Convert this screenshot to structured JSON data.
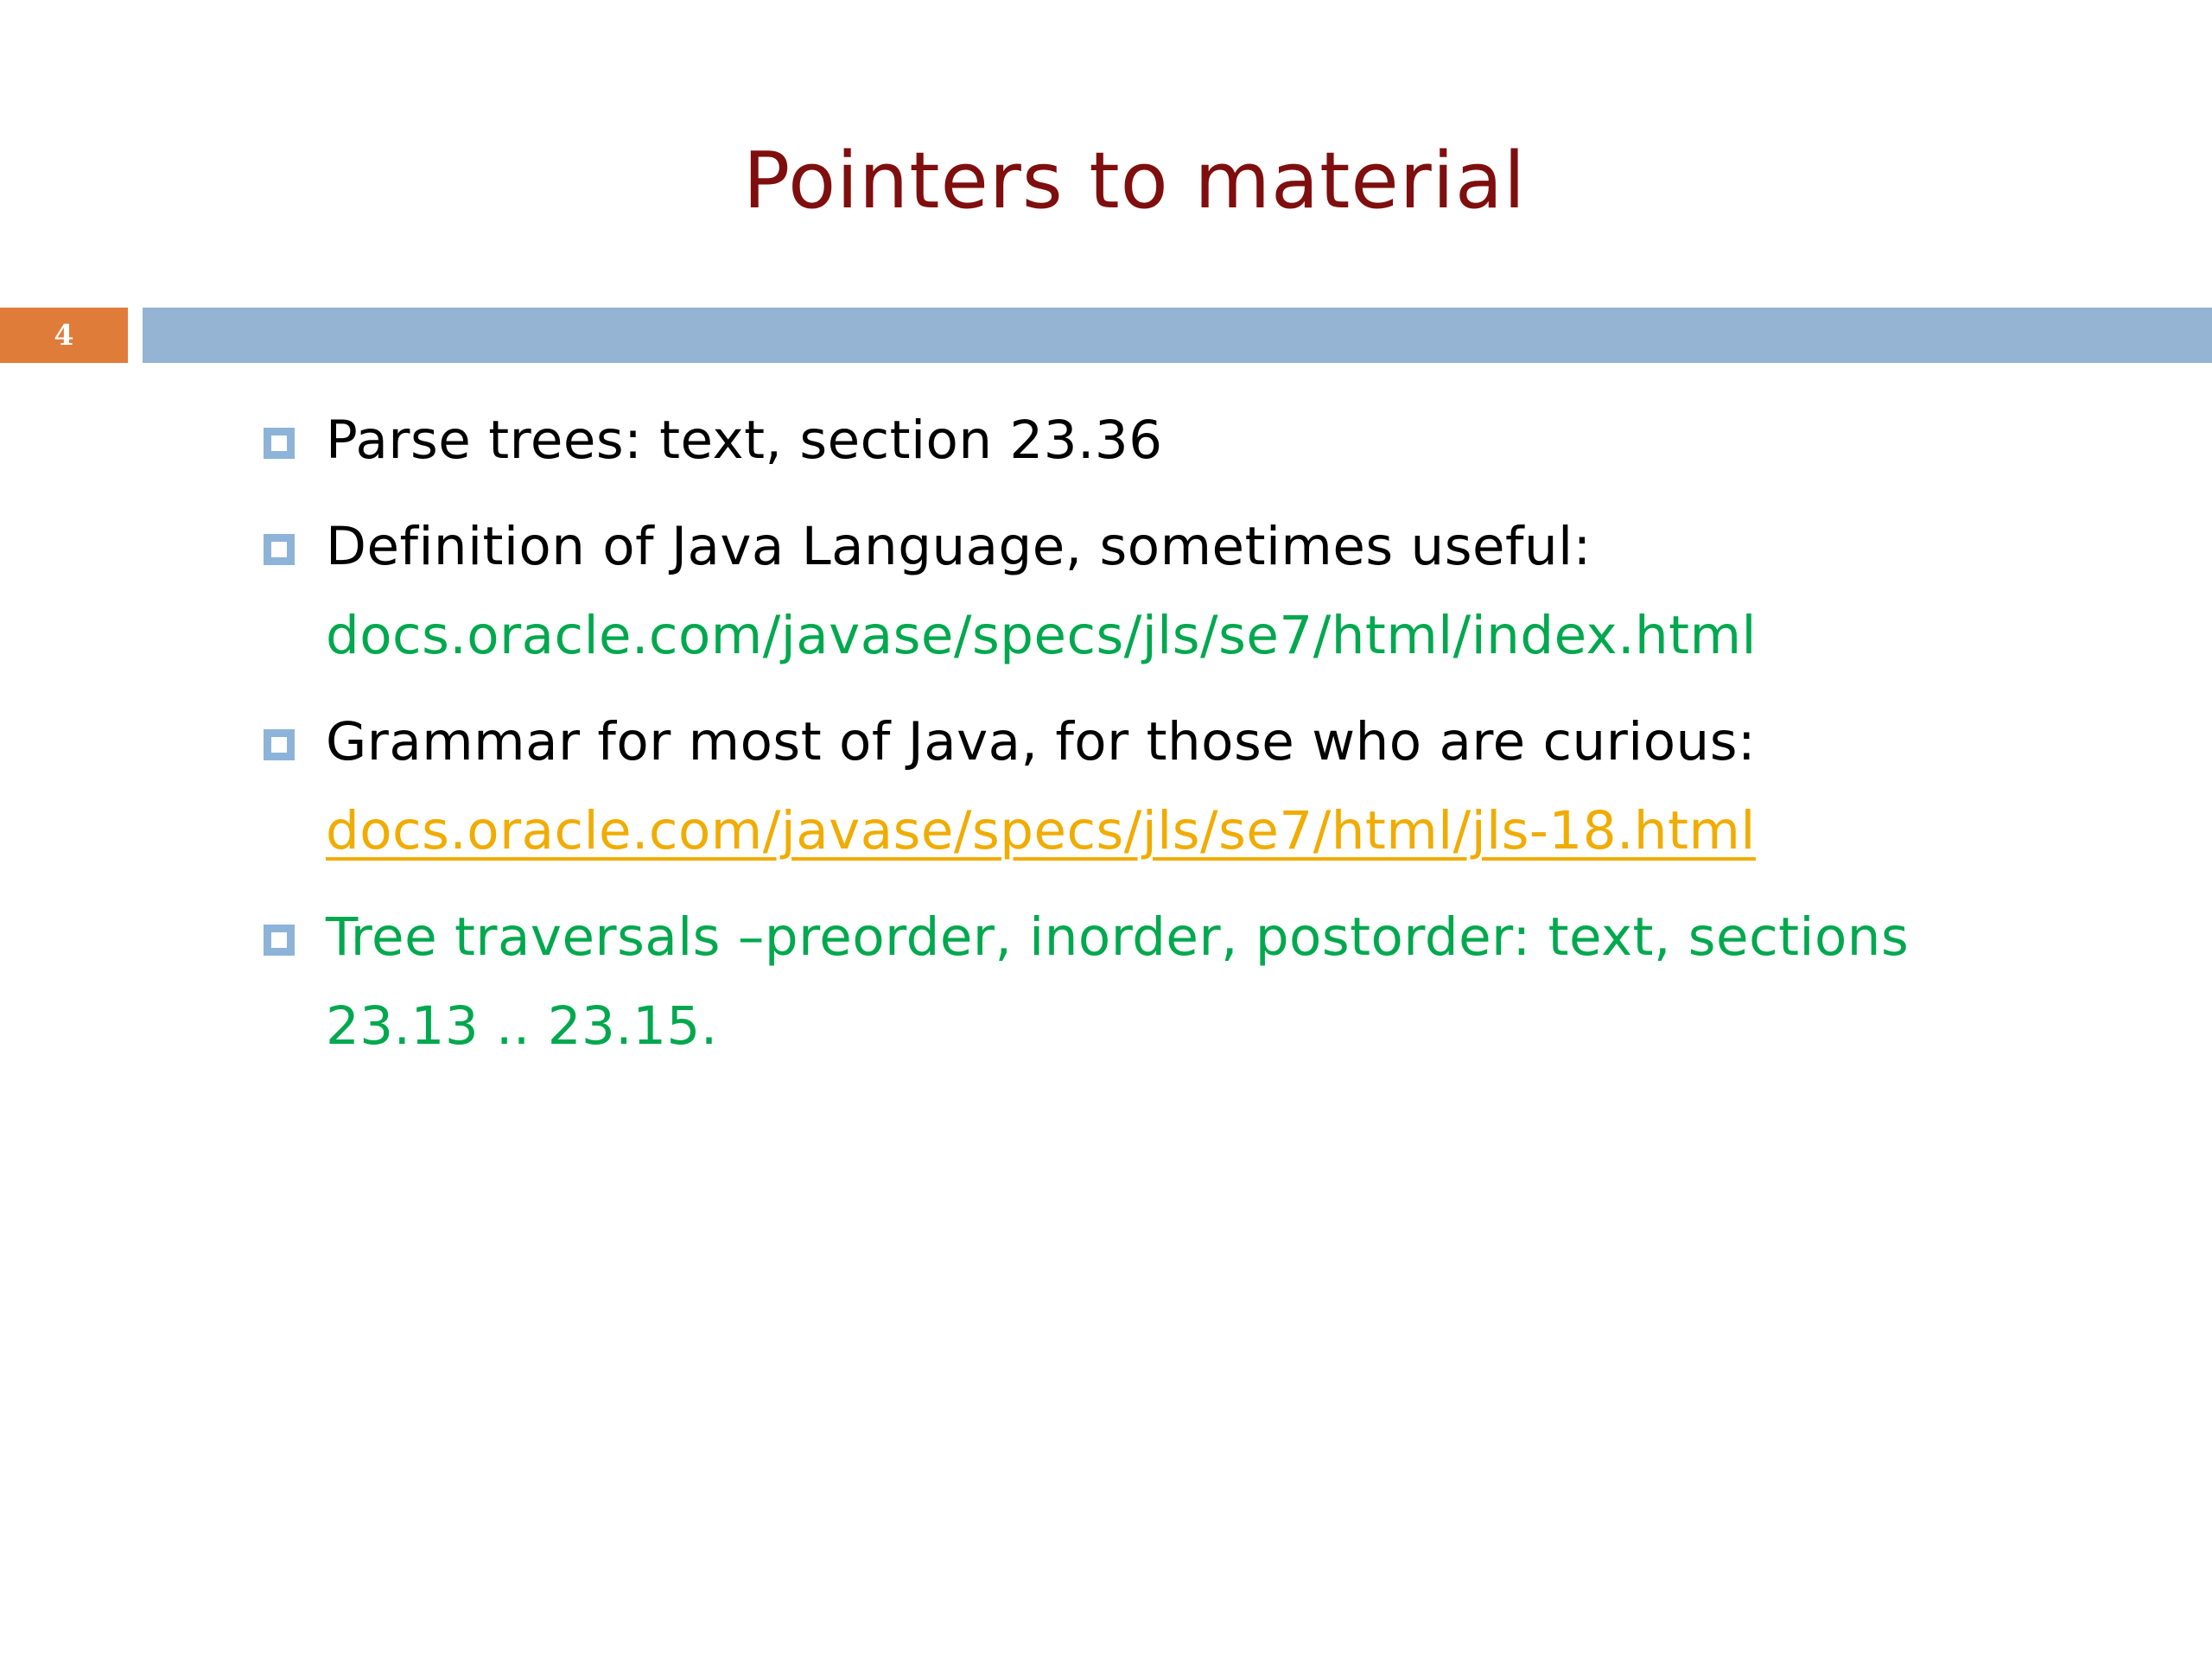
{
  "colors": {
    "title": "#7f0e0e",
    "slide_number_box": "#e07c3a",
    "header_bar": "#95b3d3",
    "bullet_marker": "#8eb3d8",
    "body_text": "#000000",
    "green_text": "#00a84e",
    "orange_link": "#f0ac00"
  },
  "slide": {
    "title": "Pointers to material",
    "number": "4"
  },
  "bullets": [
    {
      "line1": "Parse trees: text, section 23.36"
    },
    {
      "line1": "Definition of Java Language, sometimes useful:",
      "link": "docs.oracle.com/javase/specs/jls/se7/html/index.html"
    },
    {
      "line1": "Grammar for most of Java, for those who are curious:",
      "link": "docs.oracle.com/javase/specs/jls/se7/html/jls-18.html"
    },
    {
      "line1": "Tree traversals –preorder, inorder, postorder: text, sections",
      "line2": "23.13 .. 23.15."
    }
  ]
}
